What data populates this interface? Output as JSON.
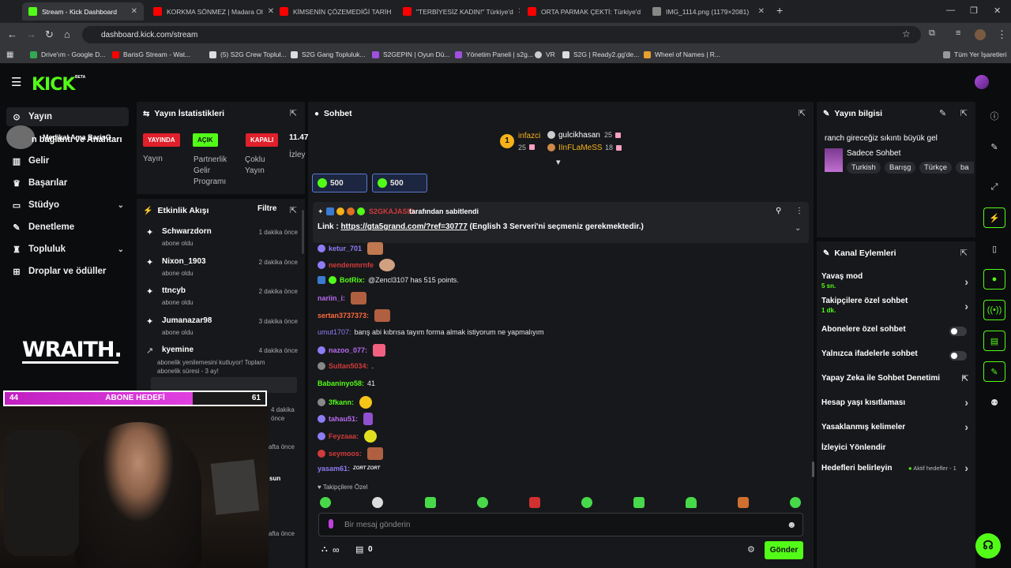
{
  "browser": {
    "tabs": [
      {
        "title": "Stream - Kick Dashboard",
        "active": true
      },
      {
        "title": "KORKMA SÖNMEZ | Madara Ol"
      },
      {
        "title": "KİMSENİN ÇÖZEMEDİĞİ TARİH"
      },
      {
        "title": "\"TERBİYESİZ KADIN!\" Türkiye'd"
      },
      {
        "title": "ORTA PARMAK ÇEKTİ: Türkiye'd"
      },
      {
        "title": "IMG_1114.png (1179×2081)"
      }
    ],
    "url": "dashboard.kick.com/stream",
    "bookmarks": [
      "Drive'ım - Google D...",
      "BarisG Stream - Wat...",
      "(5) S2G Crew Topluł...",
      "S2G Gang Topluluk...",
      "S2GEPIN | Oyun Dü...",
      "Yönetim Paneli | s2g...",
      "VR",
      "S2G | Ready2.gg'de...",
      "Wheel of Names | R..."
    ],
    "bookmarks_other": "Tüm Yer İşaretleri"
  },
  "brand": {
    "logo": "KICK",
    "beta": "BETA",
    "accent": "#53fc18"
  },
  "nav": {
    "items": [
      {
        "label": "Yayın",
        "icon": "broadcast-icon"
      },
      {
        "label": "Gelir",
        "icon": "chart-icon"
      },
      {
        "label": "Başarılar",
        "icon": "trophy-icon"
      },
      {
        "label": "Stüdyo",
        "icon": "studio-icon"
      },
      {
        "label": "Denetleme",
        "icon": "wrench-icon"
      },
      {
        "label": "Topluluk",
        "icon": "people-icon"
      },
      {
        "label": "Droplar ve ödüller",
        "icon": "gift-icon"
      }
    ],
    "overlay_text": "Medikal Ama BarisG",
    "overlay_text2": "n bağlantı ve Anahtarı"
  },
  "stats": {
    "title": "Yayın İstatistikleri",
    "badges": [
      "YAYINDA",
      "AÇIK",
      "KAPALI",
      "11.47"
    ],
    "labels": [
      "Yayın",
      "Partnerlik Gelir Programı",
      "Çoklu Yayın",
      "İzley"
    ]
  },
  "activity": {
    "title": "Etkinlik Akışı",
    "filter": "Filtre",
    "items": [
      {
        "name": "Schwarzdorn",
        "sub": "abone oldu",
        "time": "1 dakika önce"
      },
      {
        "name": "Nixon_1903",
        "sub": "abone oldu",
        "time": "2 dakika önce"
      },
      {
        "name": "ttncyb",
        "sub": "abone oldu",
        "time": "2 dakika önce"
      },
      {
        "name": "Jumanazar98",
        "sub": "abone oldu",
        "time": "3 dakika önce"
      },
      {
        "name": "kyemine",
        "sub": "abonelik yenilemesini kutluyor! Toplam abonelik süresi - 3 ay!",
        "time": "4 dakika önce"
      }
    ],
    "more_times": [
      "4 dakika önce",
      "afta önce",
      "afta önce"
    ],
    "partial": "sun"
  },
  "overlay": {
    "brand": "WRAITH.",
    "goal_label": "ABONE HEDEFİ",
    "goal_current": "44",
    "goal_target": "61",
    "goal_progress": 0.72
  },
  "chat": {
    "title": "Sohbet",
    "leader1_name": "infazci",
    "leader1_count": "25",
    "leader1_rank": "1",
    "leader2_name": "gulcikhasan",
    "leader2_count": "25",
    "leader3_name": "IInFLaMeSS",
    "leader3_count": "18",
    "gift1": "500",
    "gift2": "500",
    "pinned_by": "tarafından sabitlendi",
    "pinned_user": "S2GKAJASID",
    "pinned_link_label": "Link : ",
    "pinned_link": "https://gta5grand.com/?ref=30777",
    "pinned_rest": " (English 3 Serveri'ni seçmeniz gerekmektedir.)",
    "messages": [
      {
        "user": "ketur_701",
        "text": "",
        "color": "#8e7cf5"
      },
      {
        "user": "nendenmrnfe",
        "text": "",
        "color": "#d13b3b"
      },
      {
        "user": "BotRix:",
        "text": "@Zencl3107 has 515 points.",
        "color": "#53fc18"
      },
      {
        "user": "nariin_i:",
        "text": "",
        "color": "#b86bf0"
      },
      {
        "user": "sertan3737373:",
        "text": "",
        "color": "#ff6a3d"
      },
      {
        "user": "umut1707:",
        "text": "barış abi kıbrısa tayım forma almak istiyorum ne yapmalıyım",
        "color": "#8e7cf5"
      },
      {
        "user": "nazoo_077:",
        "text": "",
        "color": "#b86bf0"
      },
      {
        "user": "Sultan5034:",
        "text": ".",
        "color": "#d13b3b"
      },
      {
        "user": "Babaninyo58:",
        "text": "41",
        "color": "#53fc18"
      },
      {
        "user": "3fkann:",
        "text": "",
        "color": "#53fc18"
      },
      {
        "user": "tahau51:",
        "text": "",
        "color": "#b86bf0"
      },
      {
        "user": "Feyzaaa:",
        "text": "",
        "color": "#d13b3b"
      },
      {
        "user": "seymoos:",
        "text": "",
        "color": "#d13b3b"
      },
      {
        "user": "yasam61:",
        "text": "ZORT ZORT",
        "color": "#8e7cf5"
      }
    ],
    "followers_only": "Takipçilere Özel",
    "input_placeholder": "Bir mesaj gönderin",
    "points": "∞",
    "gift_count": "0",
    "send": "Gönder"
  },
  "stream_info": {
    "title": "Yayın bilgisi",
    "stream_title": "ranch gireceğiz sıkıntı büyük gel",
    "category": "Sadece Sohbet",
    "tags": [
      "Turkish",
      "Barışg",
      "Türkçe",
      "ba"
    ]
  },
  "channel_actions": {
    "title": "Kanal Eylemleri",
    "items": [
      {
        "label": "Yavaş mod",
        "sub": "5 sn.",
        "type": "arrow"
      },
      {
        "label": "Takipçilere özel sohbet",
        "sub": "1 dk.",
        "type": "arrow"
      },
      {
        "label": "Abonelere özel sohbet",
        "sub": "",
        "type": "toggle"
      },
      {
        "label": "Yalnızca ifadelerle sohbet",
        "sub": "",
        "type": "toggle"
      },
      {
        "label": "Yapay Zeka ile Sohbet Denetimi",
        "sub": "",
        "type": "external"
      },
      {
        "label": "Hesap yaşı kısıtlaması",
        "sub": "",
        "type": "arrow"
      },
      {
        "label": "Yasaklanmış kelimeler",
        "sub": "",
        "type": "arrow"
      },
      {
        "label": "İzleyici Yönlendir",
        "sub": "",
        "type": "none"
      },
      {
        "label": "Hedefleri belirleyin",
        "sub": "",
        "type": "arrow"
      }
    ],
    "goals_status": "Aktif hedefler - 1"
  }
}
